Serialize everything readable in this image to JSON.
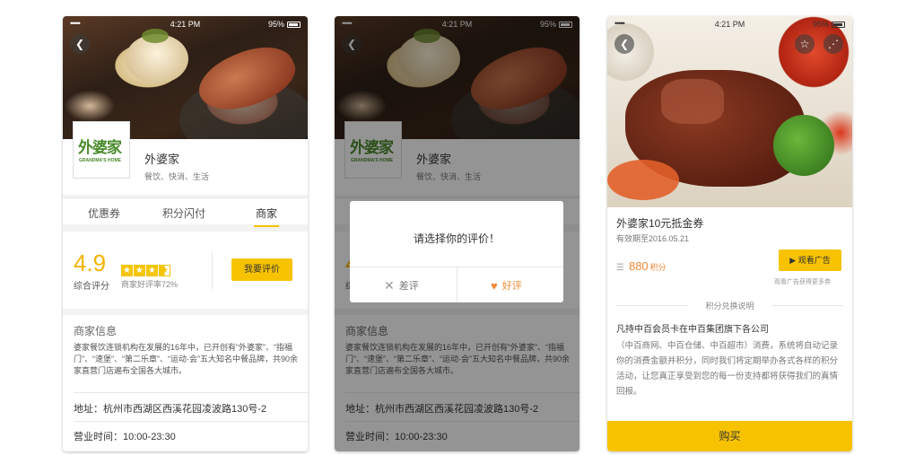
{
  "status": {
    "signal": "•••••",
    "time": "4:21 PM",
    "battery": "95%"
  },
  "shop": {
    "name": "外婆家",
    "category": "餐饮、快消、生活",
    "logo_cn": "外婆家",
    "logo_en": "GRANDMA'S HOME",
    "tabs": [
      "优惠券",
      "积分闪付",
      "商家"
    ],
    "active_tab": "商家",
    "rating": {
      "score": "4.9",
      "score_label": "综合评分",
      "stars_full": 3,
      "stars_half": 1,
      "good_rate_text": "商家好评率72%",
      "rate_button": "我要评价"
    },
    "info": {
      "title": "商家信息",
      "description": "婆家餐饮连锁机构在发展的16年中，已开创有“外婆家”、“指福门”、“速堡”、“第二乐章”、“运动·会”五大知名中餐品牌，共90余家直营门店遍布全国各大城市。",
      "address": "地址：杭州市西湖区西溪花园凌波路130号-2",
      "hours": "营业时间：10:00-23:30"
    }
  },
  "dialog": {
    "title": "请选择你的评价！",
    "bad_label": "差评",
    "good_label": "好评"
  },
  "coupon": {
    "title": "外婆家10元抵金券",
    "expiry": "有效期至2016.05.21",
    "points": "880",
    "points_unit": "积分",
    "ad_button": "观看广告",
    "ad_note": "观看广告获得更多券",
    "rules_title": "积分兑换说明",
    "rules_head": "凡持中百会员卡在中百集团旗下各公司",
    "rules_text": "（中百商网、中百仓储、中百超市）消费，系统将自动记录你的消费金额并积分，同时我们将定期举办各式各样的积分活动，让您真正享受到您的每一份支持都将获得我们的真情回报。",
    "buy_button": "购买"
  },
  "icons": [
    "back-icon",
    "star-icon",
    "share-icon",
    "close-icon",
    "heart-icon",
    "play-icon",
    "coin-icon"
  ],
  "colors": {
    "accent": "#f7c300",
    "orange": "#f08a35",
    "score": "#f3b300"
  }
}
